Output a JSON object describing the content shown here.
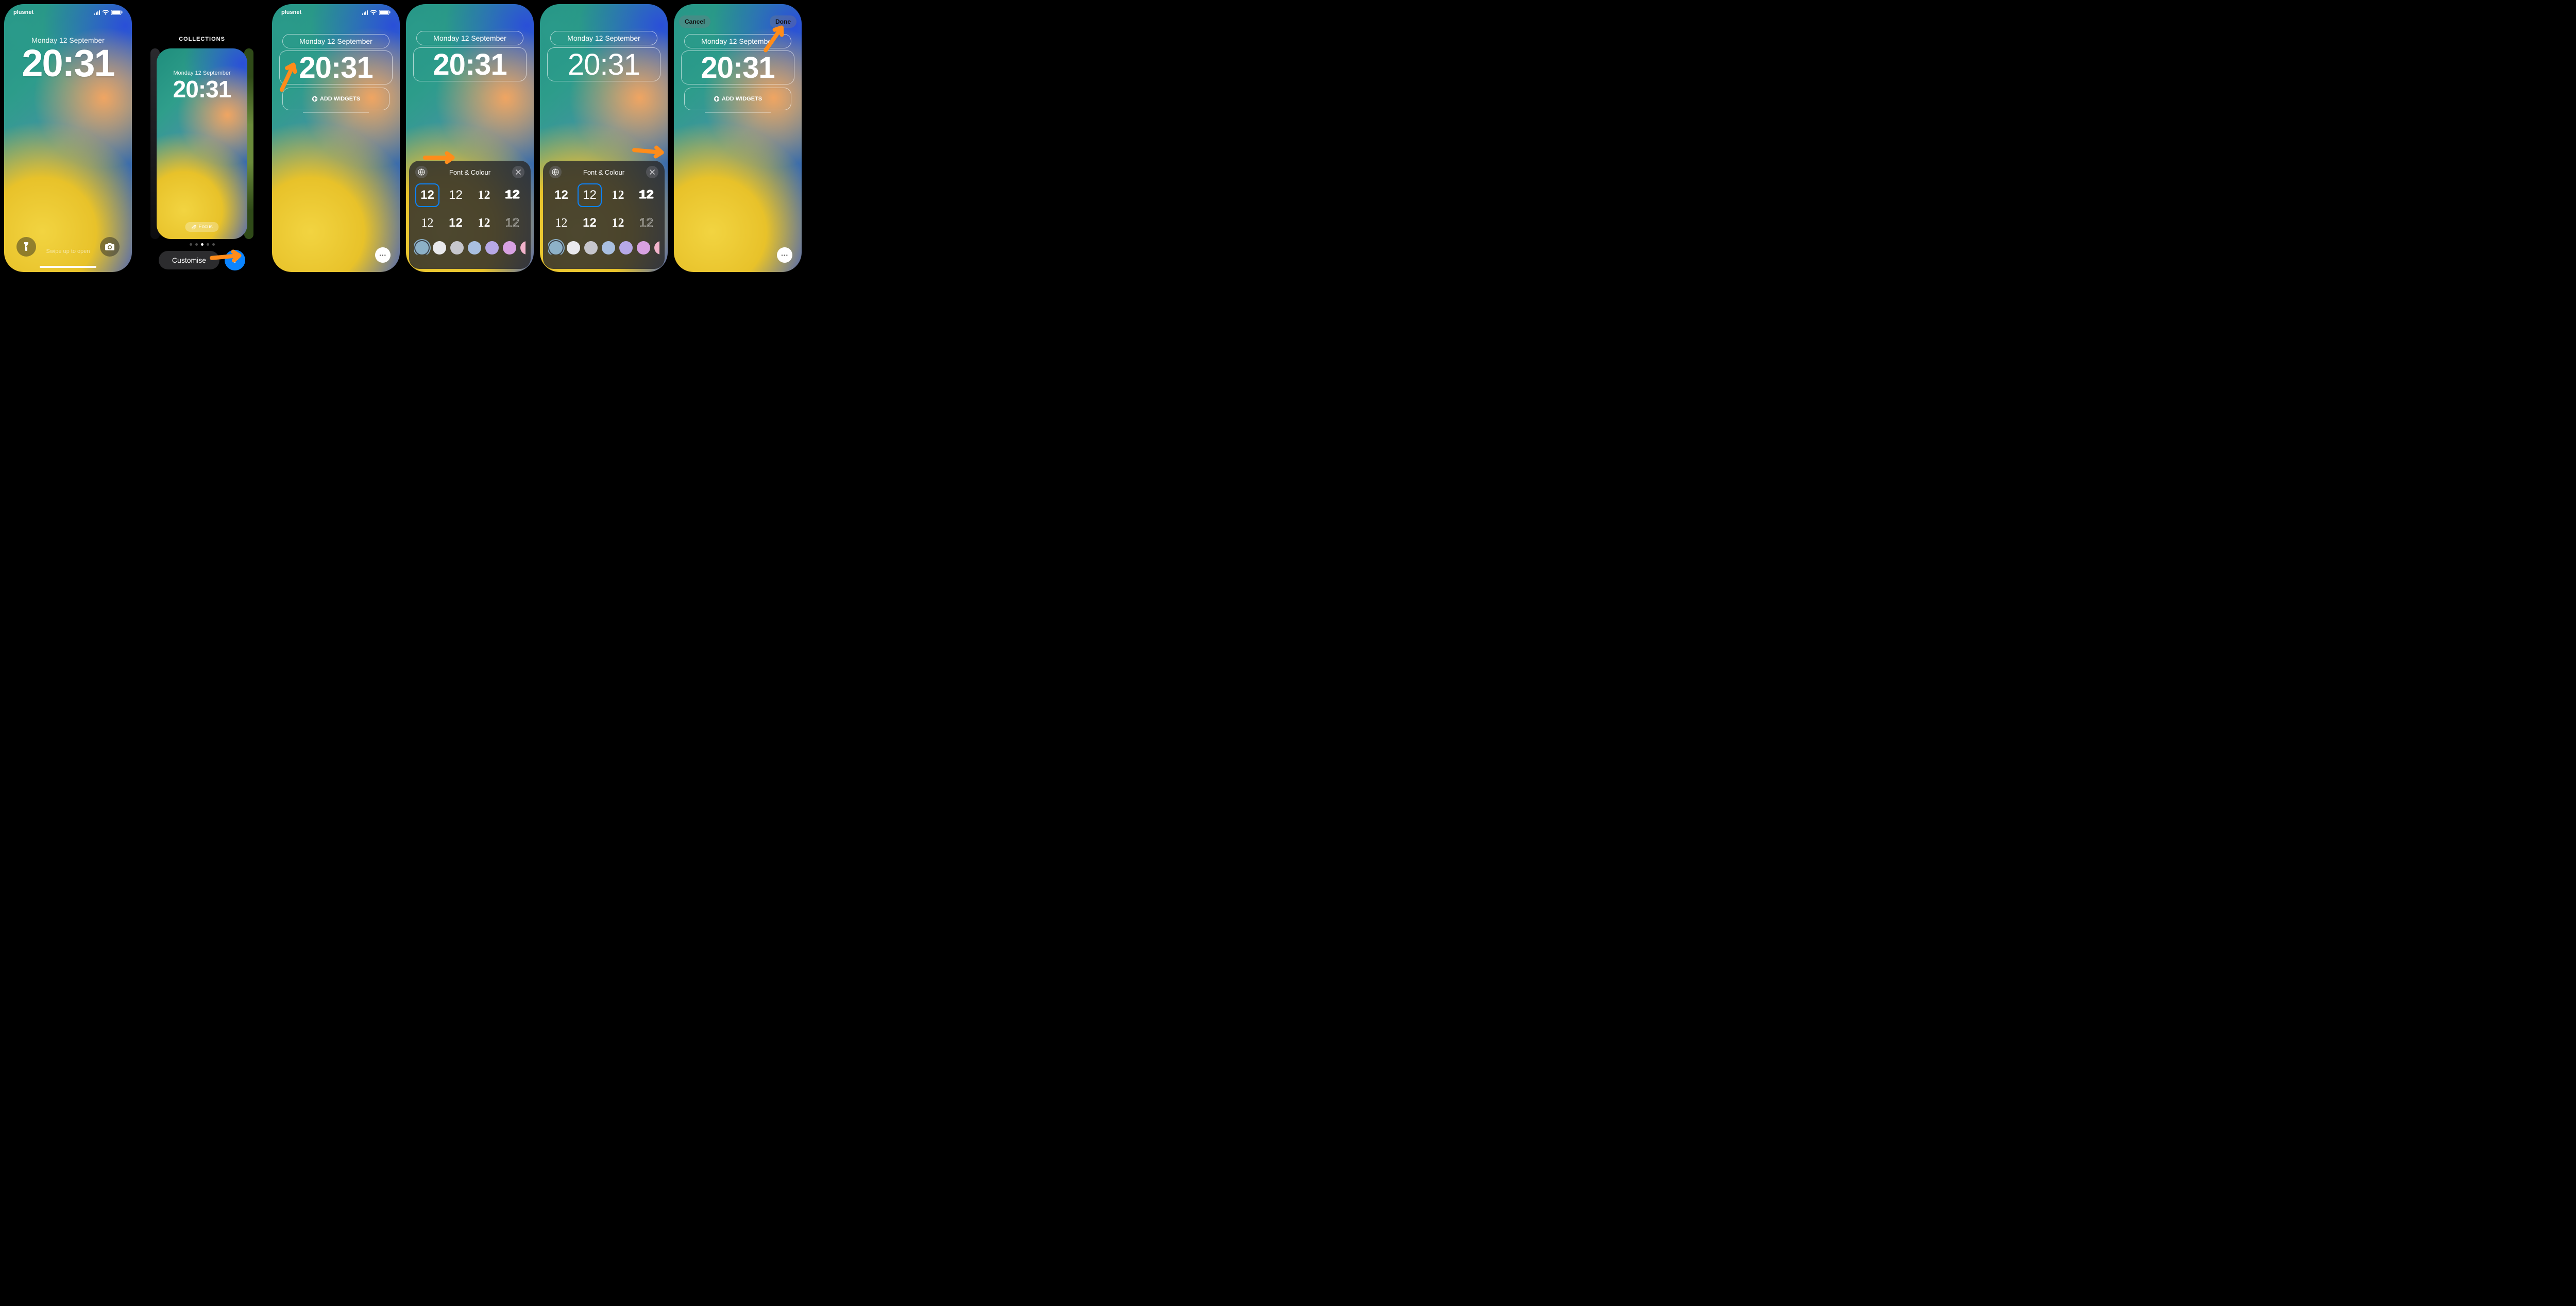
{
  "carrier": "plusnet",
  "date": "Monday 12 September",
  "time": "20:31",
  "swipe_hint": "Swipe up to open",
  "collections_label": "COLLECTIONS",
  "focus_label": "Focus",
  "customise_label": "Customise",
  "add_widgets_label": "ADD WIDGETS",
  "font_sheet_title": "Font & Colour",
  "cancel_label": "Cancel",
  "done_label": "Done",
  "font_sample": "12",
  "font_options_count": 8,
  "selected_font_index_screen4": 0,
  "selected_font_index_screen5": 1,
  "colors": [
    "#8db1c8",
    "#e9e9ec",
    "#c6c6cc",
    "#a9bfe0",
    "#b7a8e6",
    "#d8a1e2",
    "#f2b3cc"
  ],
  "selected_color_index": 0
}
